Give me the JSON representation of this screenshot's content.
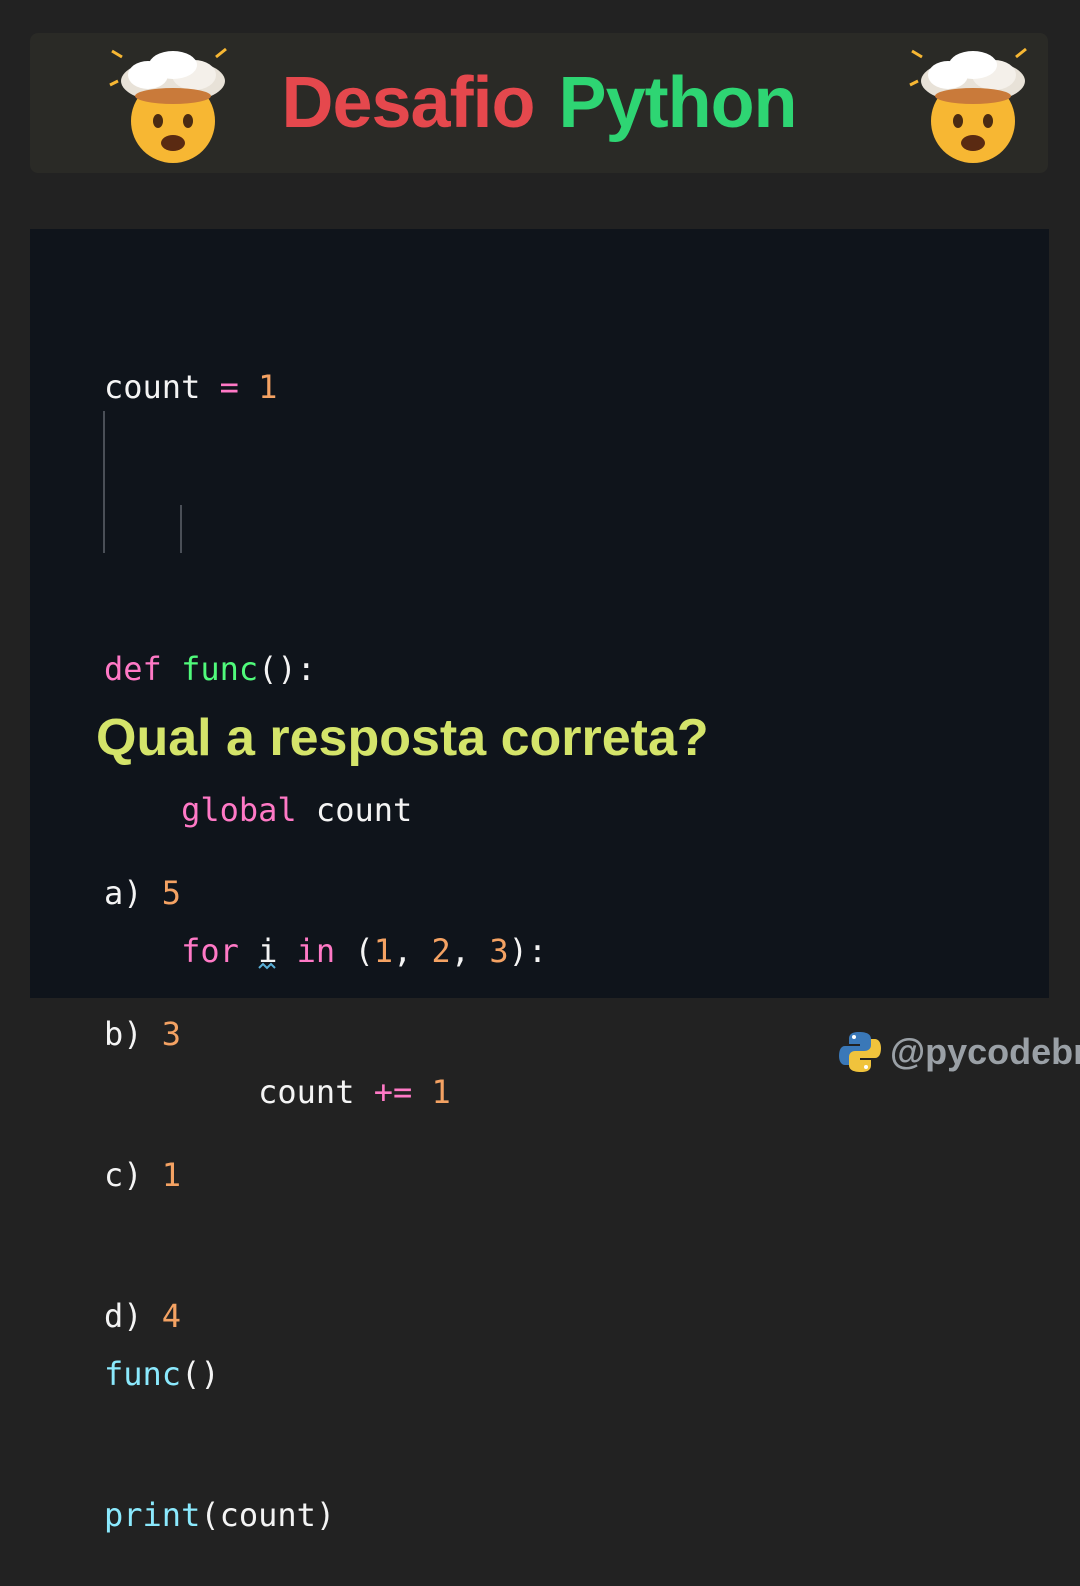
{
  "header": {
    "title_word1": "Desafio",
    "title_word2": "Python",
    "emoji_icon": "exploding-head-icon",
    "colors": {
      "word1": "#e5484d",
      "word2": "#2ed573"
    }
  },
  "code": {
    "l1_var": "count",
    "l1_op": "=",
    "l1_num": "1",
    "l3_def": "def",
    "l3_fn": "func",
    "l3_rest": "():",
    "l4_kw": "global",
    "l4_var": "count",
    "l5_for": "for",
    "l5_i": "i",
    "l5_in": "in",
    "l5_open": "(",
    "l5_n1": "1",
    "l5_c1": ", ",
    "l5_n2": "2",
    "l5_c2": ", ",
    "l5_n3": "3",
    "l5_close": "):",
    "l6_var": "count",
    "l6_op": "+=",
    "l6_num": "1",
    "l8_fn": "func",
    "l8_rest": "()",
    "l9_fn": "print",
    "l9_rest": "(count)"
  },
  "question": "Qual a resposta correta?",
  "answers": [
    {
      "label": "a)",
      "value": "5"
    },
    {
      "label": "b)",
      "value": "3"
    },
    {
      "label": "c)",
      "value": "1"
    },
    {
      "label": "d)",
      "value": "4"
    }
  ],
  "footer": {
    "logo_icon": "python-logo-icon",
    "handle": "@pycodebr"
  }
}
